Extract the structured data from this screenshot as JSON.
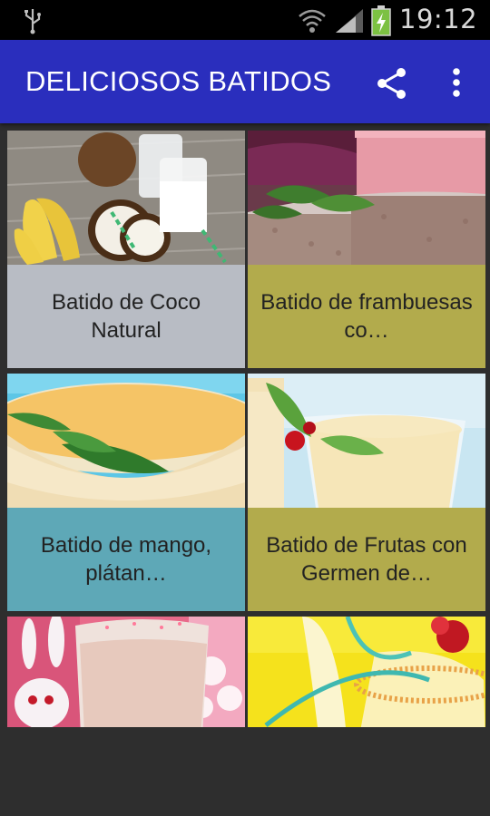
{
  "statusbar": {
    "time": "19:12",
    "icons": [
      "usb-icon",
      "wifi-icon",
      "signal-icon",
      "battery-charging-icon"
    ]
  },
  "appbar": {
    "title": "DELICIOSOS BATIDOS",
    "actions": [
      "share-icon",
      "more-vert-icon"
    ]
  },
  "colors": {
    "appbar": "#2a2ebd",
    "caption_gray": "#b8bcc4",
    "caption_olive": "#b2ab4c",
    "caption_teal": "#5ea8b7"
  },
  "items": [
    {
      "label": "Batido de Coco Natural",
      "caption_color": "#b8bcc4"
    },
    {
      "label": "Batido de frambuesas co…",
      "caption_color": "#b2ab4c"
    },
    {
      "label": "Batido de mango, plátan…",
      "caption_color": "#5ea8b7"
    },
    {
      "label": "Batido de Frutas con Germen de…",
      "caption_color": "#b2ab4c"
    },
    {
      "label": "",
      "caption_color": ""
    },
    {
      "label": "",
      "caption_color": ""
    }
  ]
}
